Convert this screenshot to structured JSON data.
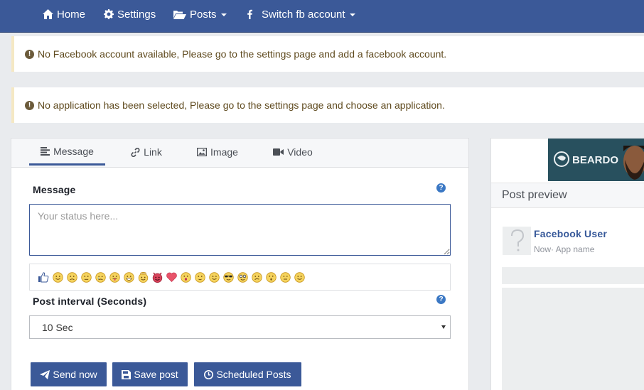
{
  "nav": {
    "home": "Home",
    "settings": "Settings",
    "posts": "Posts",
    "switch_account": "Switch fb account"
  },
  "alerts": {
    "no_account": "No Facebook account available, Please go to the settings page and add a facebook account.",
    "no_application": "No application has been selected, Please go to the settings page and choose an application."
  },
  "composer": {
    "tabs": [
      "Message",
      "Link",
      "Image",
      "Video"
    ],
    "active_tab": "Message",
    "message_label": "Message",
    "message_placeholder": "Your status here...",
    "interval_label": "Post interval (Seconds)",
    "interval_value": "10 Sec",
    "buttons": {
      "send_now": "Send now",
      "save_post": "Save post",
      "scheduled_posts": "Scheduled Posts"
    },
    "emojis": [
      "thumbs-up",
      "smile",
      "frown",
      "unsure",
      "crying",
      "tongue",
      "grin",
      "angel",
      "devil",
      "heart",
      "gasp",
      "slight-smile",
      "happy",
      "sunglasses",
      "glasses",
      "confused",
      "surprised",
      "neutral",
      "wink"
    ]
  },
  "preview": {
    "title": "Post preview",
    "banner_text": "BEARDO",
    "user_name": "Facebook User",
    "meta": "Now· App name"
  },
  "colors": {
    "brand": "#3b5998",
    "page_bg": "#e9ebee",
    "alert_border": "#f5e8c4",
    "help_icon": "#3b78c4"
  }
}
